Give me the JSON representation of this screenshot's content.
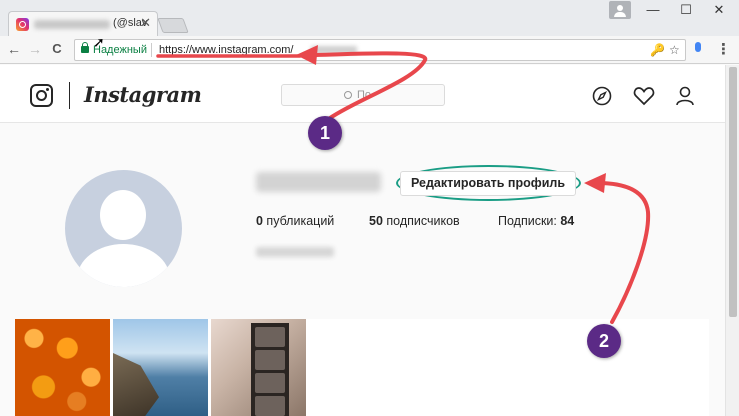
{
  "browser": {
    "tab": {
      "title": "(@slav",
      "close": "✕"
    },
    "window_controls": [
      "—",
      "☐",
      "✕"
    ],
    "nav": {
      "back": "←",
      "forward": "→",
      "reload": "C"
    },
    "omnibox": {
      "security_label": "Надежный",
      "url": "https://www.instagram.com/"
    },
    "toolbar_icons": {
      "key": "🔑",
      "star": "☆",
      "menu": "⋮"
    }
  },
  "instagram": {
    "logo_text": "Instagram",
    "search_placeholder": "По",
    "profile": {
      "edit_button": "Редактировать профиль",
      "posts_count": "0",
      "posts_label": " публикаций",
      "followers_count": "50",
      "followers_label": " подписчиков",
      "following_label": "Подписки: ",
      "following_count": "84"
    }
  },
  "annotations": {
    "badge_1": "1",
    "badge_2": "2",
    "arrow_color": "#e8474c",
    "oval_color": "#1a9d85",
    "badge_color": "#5b2a86"
  }
}
